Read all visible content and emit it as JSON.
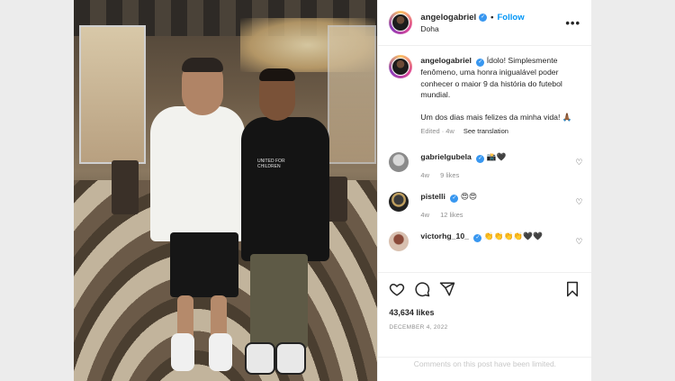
{
  "post": {
    "username": "angelogabriel",
    "follow_label": "Follow",
    "separator": "•",
    "location": "Doha",
    "more_label": "•••"
  },
  "photo": {
    "shirt_logo_text": "UNITED FOR CHILDREN"
  },
  "caption": {
    "username": "angelogabriel",
    "text_1": "Ídolo! Simplesmente fenômeno, uma honra inigualável poder conhecer o maior 9 da história do futebol mundial.",
    "text_2": "Um dos dias mais felizes da minha vida! 🙏🏾",
    "edited": "Edited",
    "age": "4w",
    "see_translation": "See translation"
  },
  "comments": [
    {
      "username": "gabrielgubela",
      "text": "📸🖤",
      "age": "4w",
      "likes": "9 likes"
    },
    {
      "username": "pistelli",
      "text": "😍😍",
      "age": "4w",
      "likes": "12 likes"
    },
    {
      "username": "victorhg_10_",
      "text": "👏👏👏👏🖤🖤",
      "age": "",
      "likes": ""
    }
  ],
  "stats": {
    "likes": "43,634 likes",
    "date": "DECEMBER 4, 2022"
  },
  "footer": {
    "limited": "Comments on this post have been limited."
  },
  "icons": {
    "like": "heart-icon",
    "comment": "comment-icon",
    "share": "share-icon",
    "save": "bookmark-icon",
    "verified": "verified-badge-icon",
    "comment_like": "heart-icon"
  },
  "colors": {
    "accent": "#0095f6",
    "verified": "#3897f0",
    "muted": "#8e8e8e",
    "text": "#262626"
  }
}
